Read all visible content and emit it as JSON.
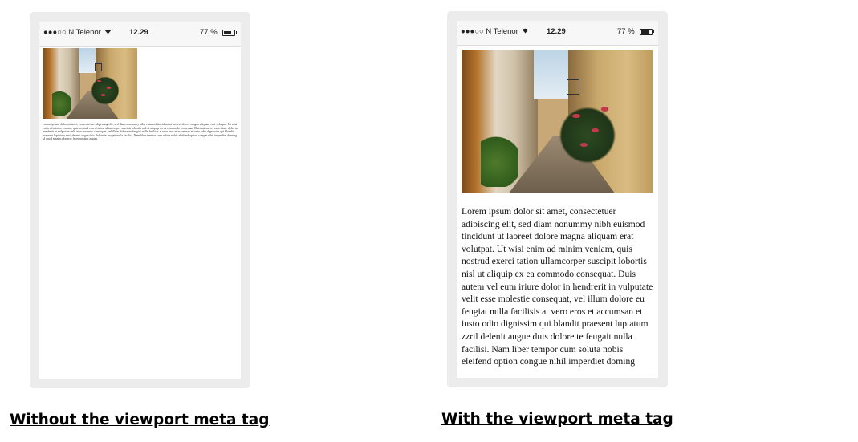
{
  "left_phone": {
    "status": {
      "carrier": "●●●○○ N Telenor",
      "time": "12.29",
      "battery": "77 %"
    },
    "body_text": "Lorem ipsum dolor sit amet, consectetuer adipiscing elit, sed diam nonummy nibh euismod tincidunt ut laoreet dolore magna aliquam erat volutpat. Ut wisi enim ad minim veniam, quis nostrud exerci tation ullamcorper suscipit lobortis nisl ut aliquip ex ea commodo consequat. Duis autem vel eum iriure dolor in hendrerit in vulputate velit esse molestie consequat, vel illum dolore eu feugiat nulla facilisis at vero eros et accumsan et iusto odio dignissim qui blandit praesent luptatum zzril delenit augue duis dolore te feugait nulla facilisi. Nam liber tempor cum soluta nobis eleifend option congue nihil imperdiet doming id quod mazim placerat facer possim assum."
  },
  "right_phone": {
    "status": {
      "carrier": "●●●○○ N Telenor",
      "time": "12.29",
      "battery": "77 %"
    },
    "body_text": "Lorem ipsum dolor sit amet, consectetuer adipiscing elit, sed diam nonummy nibh euismod tincidunt ut laoreet dolore magna aliquam erat volutpat. Ut wisi enim ad minim veniam, quis nostrud exerci tation ullamcorper suscipit lobortis nisl ut aliquip ex ea commodo consequat. Duis autem vel eum iriure dolor in hendrerit in vulputate velit esse molestie consequat, vel illum dolore eu feugiat nulla facilisis at vero eros et accumsan et iusto odio dignissim qui blandit praesent luptatum zzril delenit augue duis dolore te feugait nulla facilisi. Nam liber tempor cum soluta nobis eleifend option congue nihil imperdiet doming"
  },
  "battery_level": 0.77,
  "captions": {
    "left": "Without the viewport meta tag",
    "right": "With the viewport meta tag"
  },
  "icons": {
    "wifi": "wifi-icon",
    "battery": "battery-icon",
    "signal": "signal-dots-icon"
  }
}
